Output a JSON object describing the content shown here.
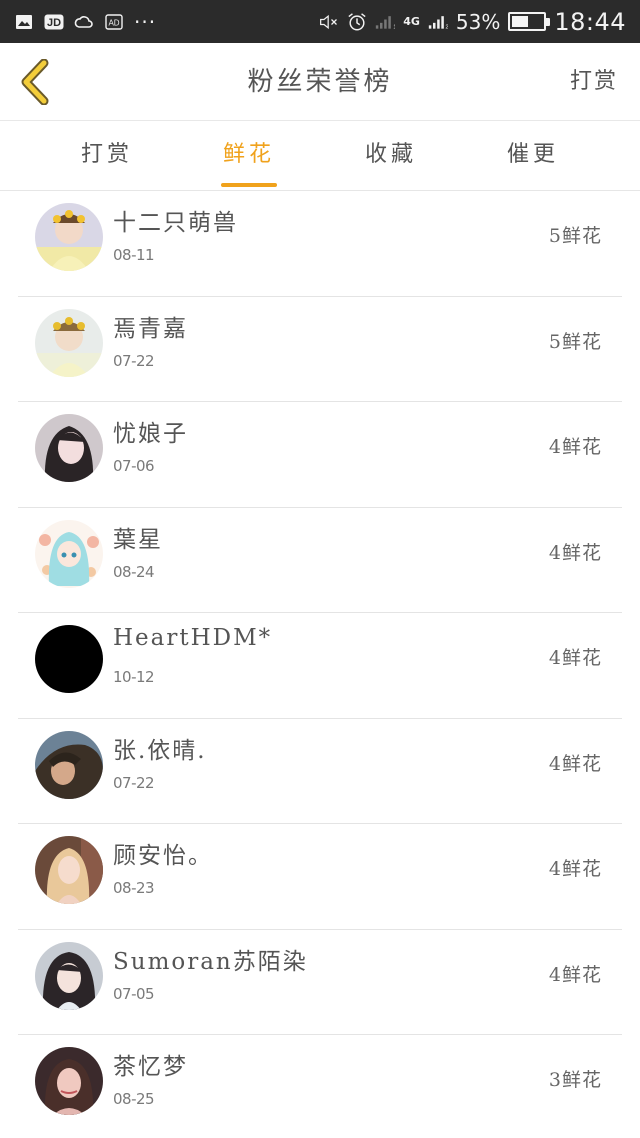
{
  "status_bar": {
    "icons": [
      "image-icon",
      "app-icon",
      "weather-icon",
      "ad-icon"
    ],
    "more": "···",
    "network": "4G",
    "battery_percent": "53%",
    "battery_level": 0.53,
    "time": "18:44"
  },
  "header": {
    "title": "粉丝荣誉榜",
    "action": "打赏",
    "back_icon": "chevron-left-icon",
    "accent": "#f0a21c"
  },
  "tabs": [
    {
      "label": "打赏",
      "active": false
    },
    {
      "label": "鲜花",
      "active": true
    },
    {
      "label": "收藏",
      "active": false
    },
    {
      "label": "催更",
      "active": false
    }
  ],
  "list": [
    {
      "name": "十二只萌兽",
      "date": "08-11",
      "gift": "5鲜花"
    },
    {
      "name": "焉青嘉",
      "date": "07-22",
      "gift": "5鲜花"
    },
    {
      "name": "忧娘子",
      "date": "07-06",
      "gift": "4鲜花"
    },
    {
      "name": "葉星",
      "date": "08-24",
      "gift": "4鲜花"
    },
    {
      "name": "HeartHDM*",
      "date": "10-12",
      "gift": "4鲜花"
    },
    {
      "name": "张.依晴.",
      "date": "07-22",
      "gift": "4鲜花"
    },
    {
      "name": "顾安怡。",
      "date": "08-23",
      "gift": "4鲜花"
    },
    {
      "name": "Sumoran苏陌染",
      "date": "07-05",
      "gift": "4鲜花"
    },
    {
      "name": "茶忆梦",
      "date": "08-25",
      "gift": "3鲜花"
    }
  ]
}
